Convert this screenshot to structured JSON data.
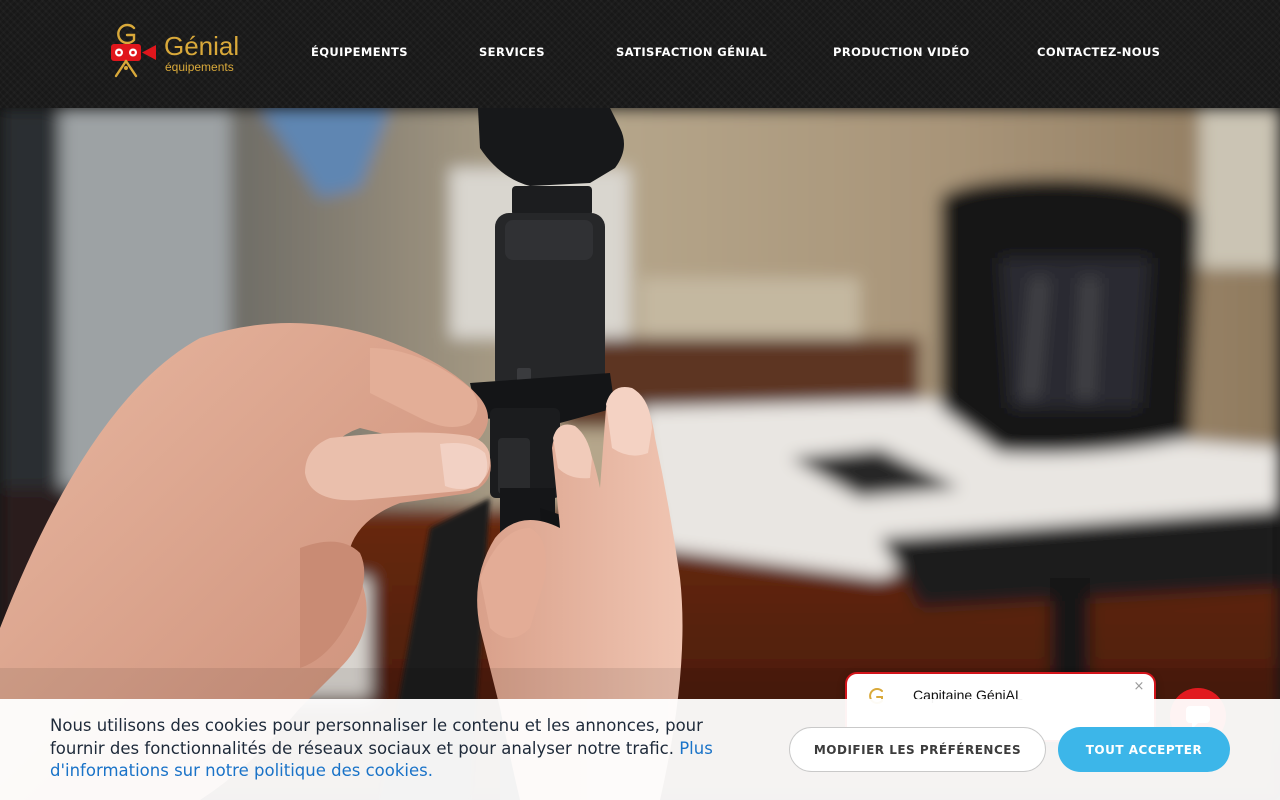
{
  "brand": {
    "name": "Génial",
    "tagline": "équipements",
    "colors": {
      "gold": "#d9a93a",
      "red": "#d3141a"
    }
  },
  "nav": {
    "items": [
      {
        "label": "ÉQUIPEMENTS"
      },
      {
        "label": "SERVICES"
      },
      {
        "label": "SATISFACTION GÉNIAL"
      },
      {
        "label": "PRODUCTION VIDÉO"
      },
      {
        "label": "CONTACTEZ-NOUS"
      }
    ]
  },
  "hero": {
    "image_icon": "hands-mounting-camera-on-tripod-photo"
  },
  "chat": {
    "agent_name": "Capitaine GéniAL",
    "close_glyph": "×",
    "avatar_icon": "genial-g-icon",
    "launcher_icon": "chat-bubble-icon"
  },
  "cookie_banner": {
    "text": "Nous utilisons des cookies pour personnaliser le contenu et les annonces, pour fournir des fonctionnalités de réseaux sociaux et pour analyser notre trafic. ",
    "link_text": "Plus d'informations sur notre politique des cookies.",
    "prefs_button": "MODIFIER LES PRÉFÉRENCES",
    "accept_button": "TOUT ACCEPTER",
    "colors": {
      "accept": "#3cb6e9",
      "link": "#1a73c8"
    }
  }
}
